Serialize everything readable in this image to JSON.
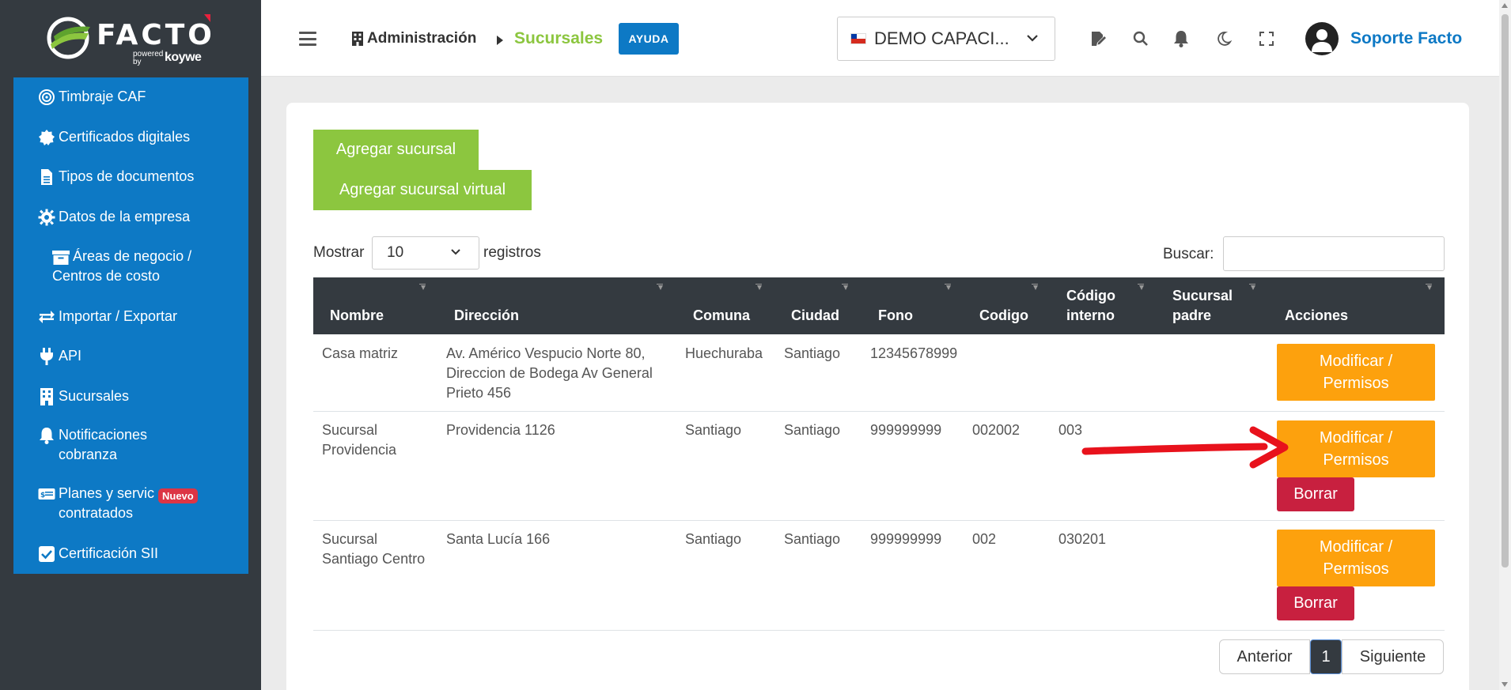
{
  "brand": {
    "name": "FACTO",
    "powered": "powered\nby",
    "koywe": "koywe"
  },
  "sidebar": {
    "items": [
      {
        "label": "Timbraje CAF",
        "icon": "target-icon"
      },
      {
        "label": "Certificados digitales",
        "icon": "certificate-icon"
      },
      {
        "label": "Tipos de documentos",
        "icon": "document-icon"
      },
      {
        "label": "Datos de la empresa",
        "icon": "gear-icon"
      },
      {
        "label": "Áreas de negocio /\nCentros de costo",
        "icon": "archive-icon"
      },
      {
        "label": "Importar / Exportar",
        "icon": "exchange-icon"
      },
      {
        "label": "API",
        "icon": "plug-icon"
      },
      {
        "label": "Sucursales",
        "icon": "building-icon"
      },
      {
        "label": "Notificaciones\ncobranza",
        "icon": "bell-icon"
      },
      {
        "label": "Planes y servic\ncontratados",
        "icon": "money-icon"
      },
      {
        "label": "Certificación SII",
        "icon": "check-square-icon"
      }
    ],
    "badge": "Nuevo"
  },
  "header": {
    "breadcrumb_parent": "Administración",
    "breadcrumb_current": "Sucursales",
    "help": "AYUDA",
    "company": "DEMO CAPACI...",
    "user": "Soporte Facto"
  },
  "toolbar": {
    "add_branch": "Agregar sucursal",
    "add_virtual_branch": "Agregar sucursal virtual"
  },
  "table_controls": {
    "show_label": "Mostrar",
    "page_size": "10",
    "records_label": "registros",
    "search_label": "Buscar:"
  },
  "table": {
    "columns": [
      "Nombre",
      "Dirección",
      "Comuna",
      "Ciudad",
      "Fono",
      "Codigo",
      "Código\ninterno",
      "Sucursal\npadre",
      "Acciones"
    ],
    "rows": [
      {
        "nombre": "Casa matriz",
        "direccion": "Av. Américo Vespucio Norte 80,\nDireccion de Bodega Av General\nPrieto 456",
        "comuna": "Huechuraba",
        "ciudad": "Santiago",
        "fono": "12345678999",
        "codigo": "",
        "codigo_interno": "",
        "sucursal_padre": ""
      },
      {
        "nombre": "Sucursal\nProvidencia",
        "direccion": "Providencia 1126",
        "comuna": "Santiago",
        "ciudad": "Santiago",
        "fono": "999999999",
        "codigo": "002002",
        "codigo_interno": "003",
        "sucursal_padre": ""
      },
      {
        "nombre": "Sucursal\nSantiago Centro",
        "direccion": "Santa Lucía 166",
        "comuna": "Santiago",
        "ciudad": "Santiago",
        "fono": "999999999",
        "codigo": "002",
        "codigo_interno": "030201",
        "sucursal_padre": ""
      }
    ],
    "modify_label": "Modificar /\nPermisos",
    "delete_label": "Borrar"
  },
  "pagination": {
    "prev": "Anterior",
    "page": "1",
    "next": "Siguiente"
  },
  "colors": {
    "primary": "#0d79c5",
    "green": "#8cc63f",
    "orange": "#fda10d",
    "red": "#c8203f",
    "dark": "#343a40",
    "arrow": "#e8121c"
  }
}
